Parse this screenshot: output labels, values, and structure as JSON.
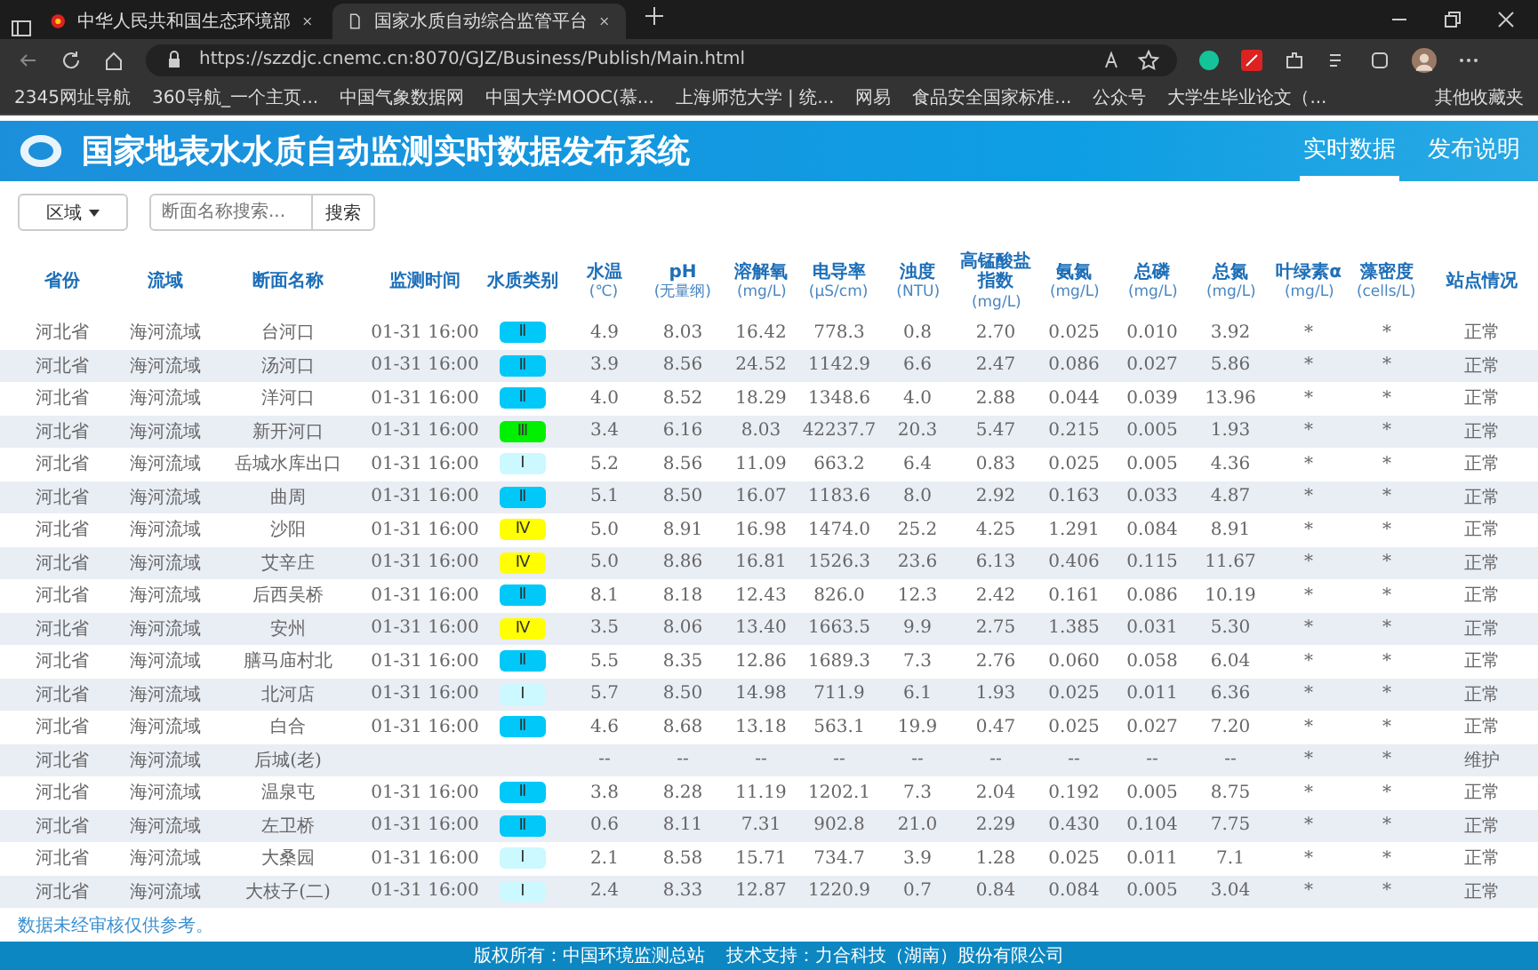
{
  "browser": {
    "tabs": [
      {
        "title": "中华人民共和国生态环境部",
        "selected": false
      },
      {
        "title": "国家水质自动综合监管平台",
        "selected": true
      }
    ],
    "address": "https://szzdjc.cnemc.cn:8070/GJZ/Business/Publish/Main.html",
    "bookmarks": [
      "2345网址导航",
      "360导航_一个主页...",
      "中国气象数据网",
      "中国大学MOOC(慕...",
      "上海师范大学 | 统...",
      "网易",
      "食品安全国家标准...",
      "公众号",
      "大学生毕业论文（..."
    ],
    "other_bookmarks": "其他收藏夹"
  },
  "header": {
    "title": "国家地表水水质自动监测实时数据发布系统",
    "nav": [
      {
        "label": "实时数据",
        "selected": true
      },
      {
        "label": "发布说明",
        "selected": false
      }
    ]
  },
  "filters": {
    "region": "区域",
    "search": {
      "placeholder": "断面名称搜索..."
    },
    "search_button": "搜索"
  },
  "table": {
    "columns": [
      {
        "name": "省份"
      },
      {
        "name": "流域"
      },
      {
        "name": "断面名称"
      },
      {
        "name": "监测时间"
      },
      {
        "name": "水质类别"
      },
      {
        "name": "水温",
        "unit": "(℃)"
      },
      {
        "name": "pH",
        "unit": "(无量纲)"
      },
      {
        "name": "溶解氧",
        "unit": "(mg/L)"
      },
      {
        "name": "电导率",
        "unit": "(μS/cm)"
      },
      {
        "name": "浊度",
        "unit": "(NTU)"
      },
      {
        "name": "高锰酸盐指数",
        "unit": "(mg/L)"
      },
      {
        "name": "氨氮",
        "unit": "(mg/L)"
      },
      {
        "name": "总磷",
        "unit": "(mg/L)"
      },
      {
        "name": "总氮",
        "unit": "(mg/L)"
      },
      {
        "name": "叶绿素α",
        "unit": "(mg/L)"
      },
      {
        "name": "藻密度",
        "unit": "(cells/L)"
      },
      {
        "name": "站点情况"
      }
    ],
    "rows": [
      {
        "province": "河北省",
        "basin": "海河流域",
        "site": "台河口",
        "time": "01-31 16:00",
        "water_class": {
          "label": "Ⅱ",
          "color": "#00c8f8"
        },
        "readings": [
          "4.9",
          "8.03",
          "16.42",
          "778.3",
          "0.8",
          "2.70",
          "0.025",
          "0.010",
          "3.92",
          "*",
          "*"
        ],
        "status": "正常"
      },
      {
        "province": "河北省",
        "basin": "海河流域",
        "site": "汤河口",
        "time": "01-31 16:00",
        "water_class": {
          "label": "Ⅱ",
          "color": "#00c8f8"
        },
        "readings": [
          "3.9",
          "8.56",
          "24.52",
          "1142.9",
          "6.6",
          "2.47",
          "0.086",
          "0.027",
          "5.86",
          "*",
          "*"
        ],
        "status": "正常"
      },
      {
        "province": "河北省",
        "basin": "海河流域",
        "site": "洋河口",
        "time": "01-31 16:00",
        "water_class": {
          "label": "Ⅱ",
          "color": "#00c8f8"
        },
        "readings": [
          "4.0",
          "8.52",
          "18.29",
          "1348.6",
          "4.0",
          "2.88",
          "0.044",
          "0.039",
          "13.96",
          "*",
          "*"
        ],
        "status": "正常"
      },
      {
        "province": "河北省",
        "basin": "海河流域",
        "site": "新开河口",
        "time": "01-31 16:00",
        "water_class": {
          "label": "Ⅲ",
          "color": "#00f000"
        },
        "readings": [
          "3.4",
          "6.16",
          "8.03",
          "42237.7",
          "20.3",
          "5.47",
          "0.215",
          "0.005",
          "1.93",
          "*",
          "*"
        ],
        "status": "正常"
      },
      {
        "province": "河北省",
        "basin": "海河流域",
        "site": "岳城水库出口",
        "time": "01-31 16:00",
        "water_class": {
          "label": "Ⅰ",
          "color": "#ccf8ff"
        },
        "readings": [
          "5.2",
          "8.56",
          "11.09",
          "663.2",
          "6.4",
          "0.83",
          "0.025",
          "0.005",
          "4.36",
          "*",
          "*"
        ],
        "status": "正常"
      },
      {
        "province": "河北省",
        "basin": "海河流域",
        "site": "曲周",
        "time": "01-31 16:00",
        "water_class": {
          "label": "Ⅱ",
          "color": "#00c8f8"
        },
        "readings": [
          "5.1",
          "8.50",
          "16.07",
          "1183.6",
          "8.0",
          "2.92",
          "0.163",
          "0.033",
          "4.87",
          "*",
          "*"
        ],
        "status": "正常"
      },
      {
        "province": "河北省",
        "basin": "海河流域",
        "site": "沙阳",
        "time": "01-31 16:00",
        "water_class": {
          "label": "Ⅳ",
          "color": "#ffff00"
        },
        "readings": [
          "5.0",
          "8.91",
          "16.98",
          "1474.0",
          "25.2",
          "4.25",
          "1.291",
          "0.084",
          "8.91",
          "*",
          "*"
        ],
        "status": "正常"
      },
      {
        "province": "河北省",
        "basin": "海河流域",
        "site": "艾辛庄",
        "time": "01-31 16:00",
        "water_class": {
          "label": "Ⅳ",
          "color": "#ffff00"
        },
        "readings": [
          "5.0",
          "8.86",
          "16.81",
          "1526.3",
          "23.6",
          "6.13",
          "0.406",
          "0.115",
          "11.67",
          "*",
          "*"
        ],
        "status": "正常"
      },
      {
        "province": "河北省",
        "basin": "海河流域",
        "site": "后西吴桥",
        "time": "01-31 16:00",
        "water_class": {
          "label": "Ⅱ",
          "color": "#00c8f8"
        },
        "readings": [
          "8.1",
          "8.18",
          "12.43",
          "826.0",
          "12.3",
          "2.42",
          "0.161",
          "0.086",
          "10.19",
          "*",
          "*"
        ],
        "status": "正常"
      },
      {
        "province": "河北省",
        "basin": "海河流域",
        "site": "安州",
        "time": "01-31 16:00",
        "water_class": {
          "label": "Ⅳ",
          "color": "#ffff00"
        },
        "readings": [
          "3.5",
          "8.06",
          "13.40",
          "1663.5",
          "9.9",
          "2.75",
          "1.385",
          "0.031",
          "5.30",
          "*",
          "*"
        ],
        "status": "正常"
      },
      {
        "province": "河北省",
        "basin": "海河流域",
        "site": "膳马庙村北",
        "time": "01-31 16:00",
        "water_class": {
          "label": "Ⅱ",
          "color": "#00c8f8"
        },
        "readings": [
          "5.5",
          "8.35",
          "12.86",
          "1689.3",
          "7.3",
          "2.76",
          "0.060",
          "0.058",
          "6.04",
          "*",
          "*"
        ],
        "status": "正常"
      },
      {
        "province": "河北省",
        "basin": "海河流域",
        "site": "北河店",
        "time": "01-31 16:00",
        "water_class": {
          "label": "Ⅰ",
          "color": "#ccf8ff"
        },
        "readings": [
          "5.7",
          "8.50",
          "14.98",
          "711.9",
          "6.1",
          "1.93",
          "0.025",
          "0.011",
          "6.36",
          "*",
          "*"
        ],
        "status": "正常"
      },
      {
        "province": "河北省",
        "basin": "海河流域",
        "site": "白合",
        "time": "01-31 16:00",
        "water_class": {
          "label": "Ⅱ",
          "color": "#00c8f8"
        },
        "readings": [
          "4.6",
          "8.68",
          "13.18",
          "563.1",
          "19.9",
          "0.47",
          "0.025",
          "0.027",
          "7.20",
          "*",
          "*"
        ],
        "status": "正常"
      },
      {
        "province": "河北省",
        "basin": "海河流域",
        "site": "后城(老)",
        "readings": [
          "--",
          "--",
          "--",
          "--",
          "--",
          "--",
          "--",
          "--",
          "--",
          "*",
          "*"
        ],
        "status": "维护"
      },
      {
        "province": "河北省",
        "basin": "海河流域",
        "site": "温泉屯",
        "time": "01-31 16:00",
        "water_class": {
          "label": "Ⅱ",
          "color": "#00c8f8"
        },
        "readings": [
          "3.8",
          "8.28",
          "11.19",
          "1202.1",
          "7.3",
          "2.04",
          "0.192",
          "0.005",
          "8.75",
          "*",
          "*"
        ],
        "status": "正常"
      },
      {
        "province": "河北省",
        "basin": "海河流域",
        "site": "左卫桥",
        "time": "01-31 16:00",
        "water_class": {
          "label": "Ⅱ",
          "color": "#00c8f8"
        },
        "readings": [
          "0.6",
          "8.11",
          "7.31",
          "902.8",
          "21.0",
          "2.29",
          "0.430",
          "0.104",
          "7.75",
          "*",
          "*"
        ],
        "status": "正常"
      },
      {
        "province": "河北省",
        "basin": "海河流域",
        "site": "大桑园",
        "time": "01-31 16:00",
        "water_class": {
          "label": "Ⅰ",
          "color": "#ccf8ff"
        },
        "readings": [
          "2.1",
          "8.58",
          "15.71",
          "734.7",
          "3.9",
          "1.28",
          "0.025",
          "0.011",
          "7.1",
          "*",
          "*"
        ],
        "status": "正常"
      },
      {
        "province": "河北省",
        "basin": "海河流域",
        "site": "大枝子(二)",
        "time": "01-31 16:00",
        "water_class": {
          "label": "Ⅰ",
          "color": "#ccf8ff"
        },
        "readings": [
          "2.4",
          "8.33",
          "12.87",
          "1220.9",
          "0.7",
          "0.84",
          "0.084",
          "0.005",
          "3.04",
          "*",
          "*"
        ],
        "status": "正常"
      }
    ]
  },
  "note": "数据未经审核仅供参考。",
  "footer": {
    "copyright": "版权所有：中国环境监测总站",
    "support": "技术支持：力合科技（湖南）股份有限公司"
  }
}
